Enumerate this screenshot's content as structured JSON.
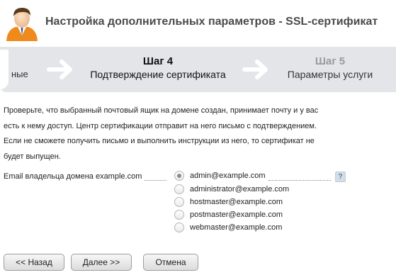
{
  "header": {
    "title": "Настройка дополнительных параметров - SSL-сертификат",
    "icon": "user-avatar-icon"
  },
  "wizard": {
    "prev_label": "ные",
    "current_step": {
      "title": "Шаг 4",
      "subtitle": "Подтверждение сертификата"
    },
    "next_step": {
      "title": "Шаг 5",
      "subtitle": "Параметры услуги"
    },
    "colors": {
      "bar": "#e3e5e9",
      "arrow": "#ffffff",
      "inactive_title": "#9a9a9a"
    }
  },
  "description": {
    "line1": "Проверьте, что выбранный почтовый ящик на домене создан, принимает почту и у вас",
    "line2": "есть к нему доступ. Центр сертификации отправит на него письмо с подтверждением.",
    "line3": "Если не сможете получить письмо и выполнить инструкции из него, то сертификат не",
    "line4": "будет выпущен."
  },
  "email_field": {
    "label": "Email владельца домена example.com",
    "selected": "admin@example.com",
    "options": [
      "admin@example.com",
      "administrator@example.com",
      "hostmaster@example.com",
      "postmaster@example.com",
      "webmaster@example.com"
    ],
    "help_label": "?"
  },
  "buttons": {
    "back": "<< Назад",
    "next": "Далее >>",
    "cancel": "Отмена"
  }
}
